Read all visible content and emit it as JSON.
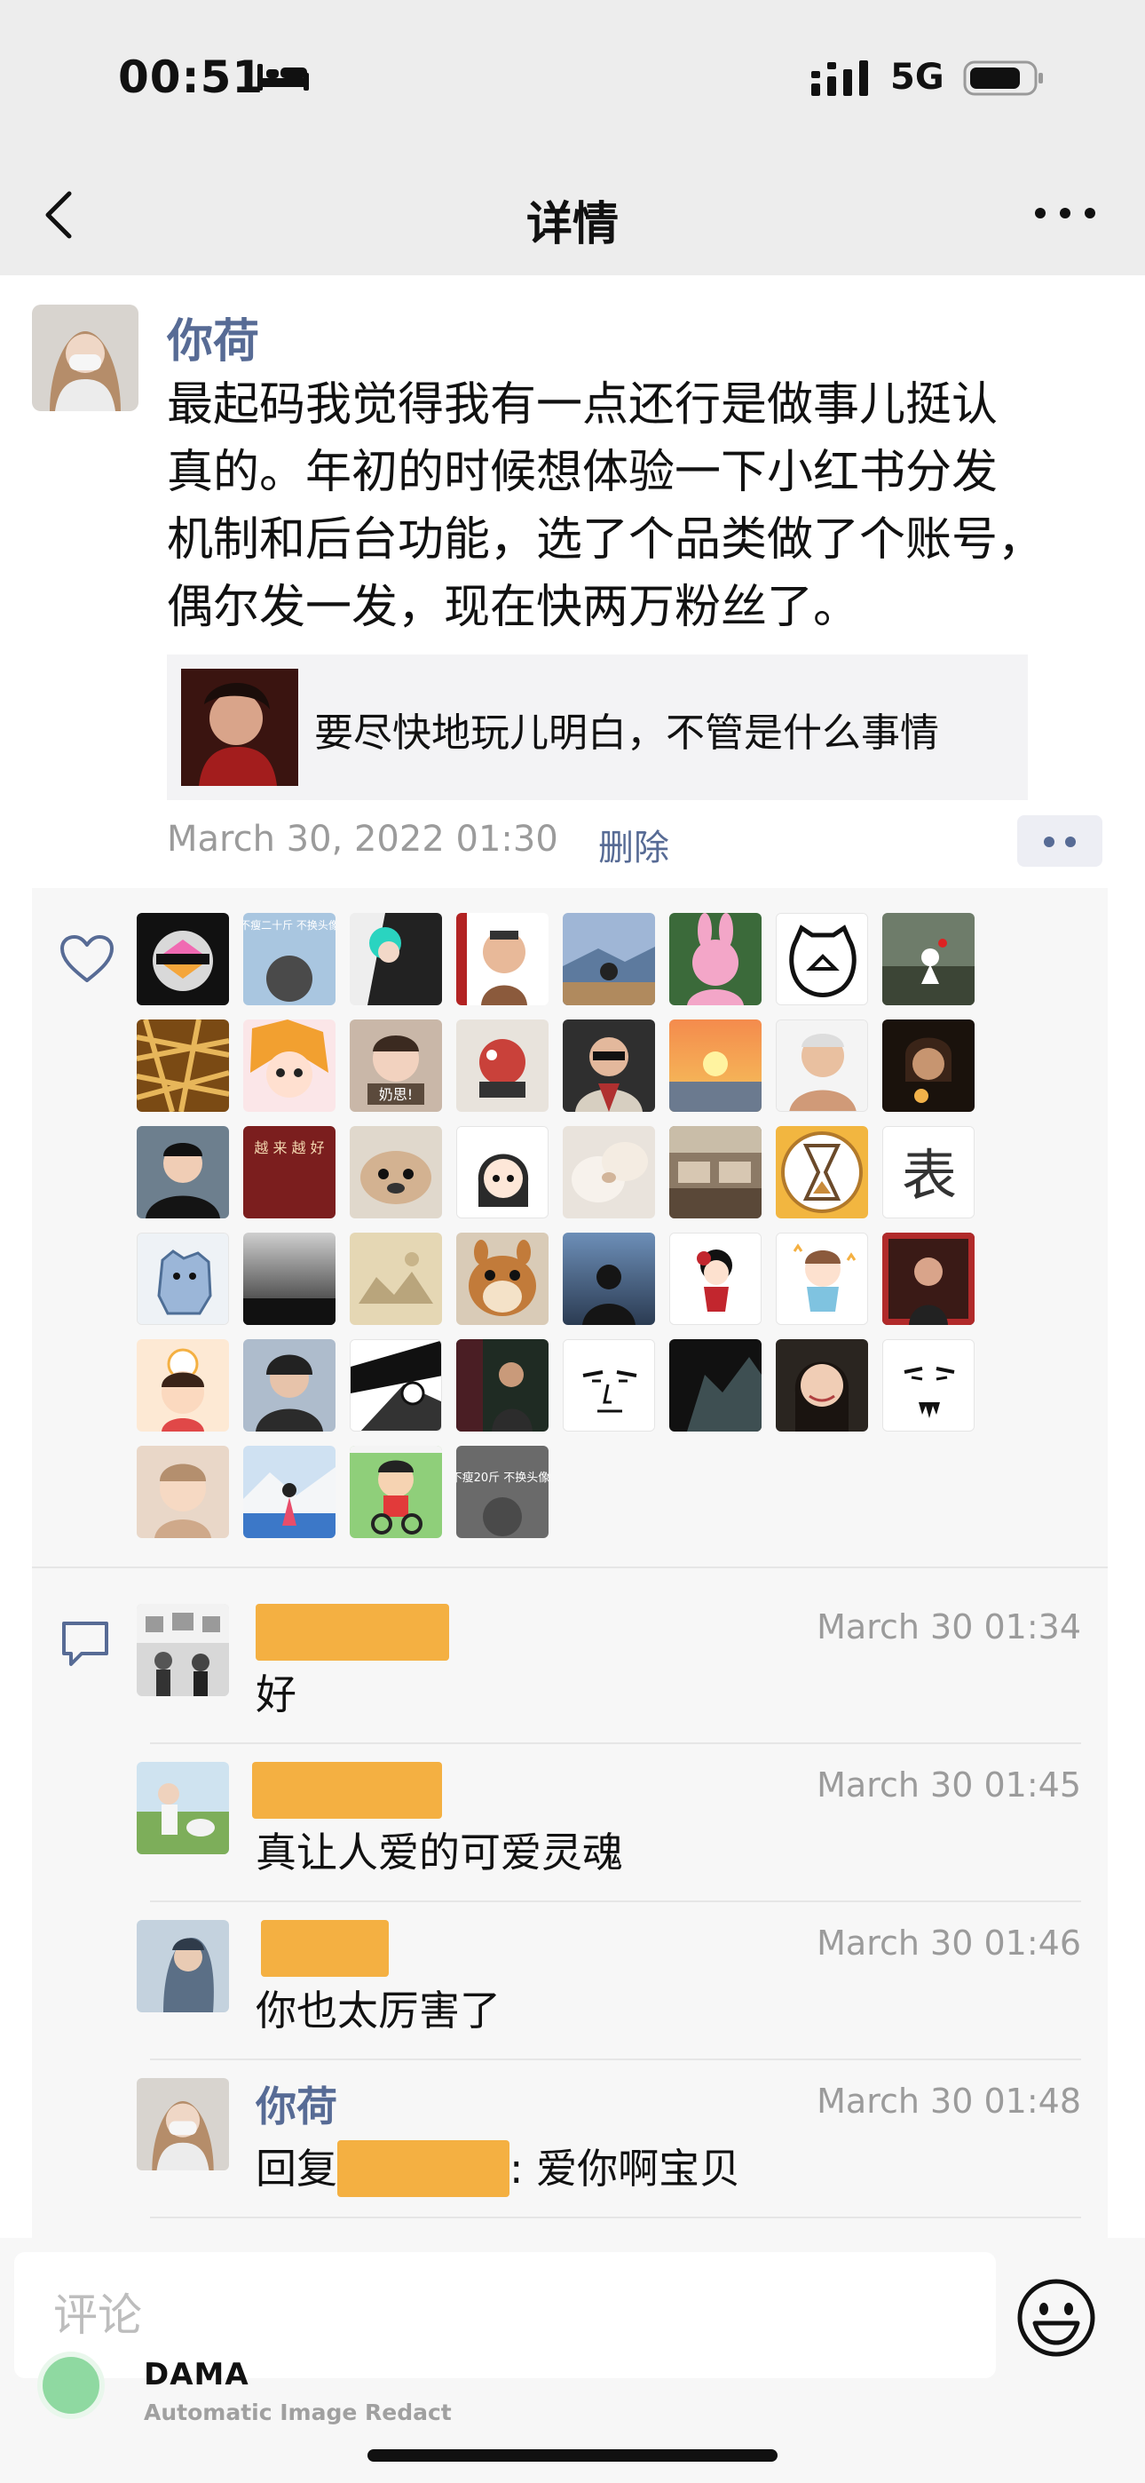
{
  "status_bar": {
    "time": "00:51",
    "network": "5G",
    "icons": [
      "bed-icon",
      "signal-icon",
      "battery-icon"
    ]
  },
  "nav": {
    "title": "详情",
    "back_icon": "chevron-left-icon",
    "more_icon": "more-dots-icon"
  },
  "post": {
    "author": "你荷",
    "text_lines": [
      "最起码我觉得我有一点还行是做事儿挺认",
      "真的。年初的时候想体验一下小红书分发",
      "机制和后台功能，选了个品类做了个账号，",
      "偶尔发一发，现在快两万粉丝了。"
    ],
    "share_card_title": "要尽快地玩儿明白，不管是什么事情",
    "timestamp": "March 30, 2022 01:30",
    "delete_label": "删除"
  },
  "likes": {
    "count": 44,
    "avatar_texts": {
      "1": "不瘦二十斤 不换头像",
      "18": "奶思!",
      "24": "越 来 越 好",
      "31": "表",
      "43": "不瘦20斤 不换头像!"
    }
  },
  "comments": [
    {
      "name": "",
      "time": "March 30 01:34",
      "text": "好"
    },
    {
      "name": "",
      "time": "March 30 01:45",
      "text": "真让人爱的可爱灵魂"
    },
    {
      "name": "",
      "time": "March 30 01:46",
      "text": "你也太厉害了"
    },
    {
      "name": "你荷",
      "time": "March 30 01:48",
      "reply_prefix": "回复",
      "text": ": 爱你啊宝贝"
    }
  ],
  "input": {
    "placeholder": "评论",
    "emoji_icon": "smiley-icon"
  },
  "watermark": {
    "title": "DAMA",
    "subtitle": "Automatic Image Redact"
  },
  "colors": {
    "link_blue": "#576b95",
    "redaction": "#f4b042",
    "header_bg": "#ededed",
    "panel_bg": "#f7f7f7"
  }
}
